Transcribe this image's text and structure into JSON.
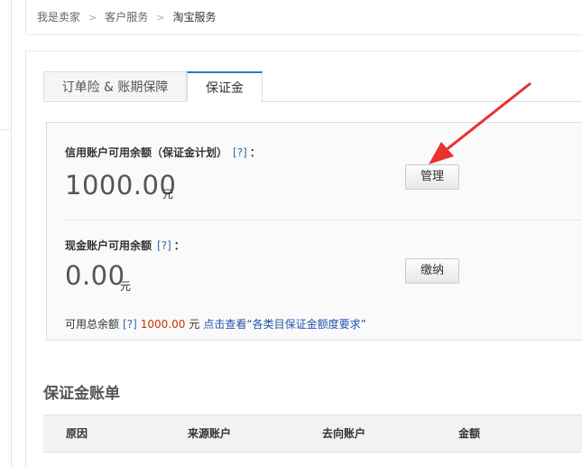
{
  "breadcrumb": {
    "items": [
      "我是卖家",
      "客户服务",
      "淘宝服务"
    ],
    "separator": ">"
  },
  "tabs": [
    {
      "label": "订单险 & 账期保障",
      "active": false
    },
    {
      "label": "保证金",
      "active": true
    }
  ],
  "credit": {
    "label": "信用账户可用余额（保证金计划）",
    "help": "[?]",
    "colon": "：",
    "amount": "1000.00",
    "unit": "元",
    "button": "管理"
  },
  "cash": {
    "label": "现金账户可用余额",
    "help": "[?]",
    "colon": "：",
    "amount": "0.00",
    "unit": "元",
    "button": "缴纳"
  },
  "summary": {
    "label": "可用总余额",
    "help": "[?]",
    "total": "1000.00",
    "unit": "元",
    "link": "点击查看“各类目保证金额度要求”"
  },
  "bill": {
    "title": "保证金账单",
    "columns": [
      "原因",
      "来源账户",
      "去向账户",
      "金额"
    ]
  },
  "colors": {
    "accent": "#2d78c6",
    "arrow": "#e8322f",
    "amount_highlight": "#cc3300"
  },
  "icons": [
    "red-annotation-arrow"
  ]
}
